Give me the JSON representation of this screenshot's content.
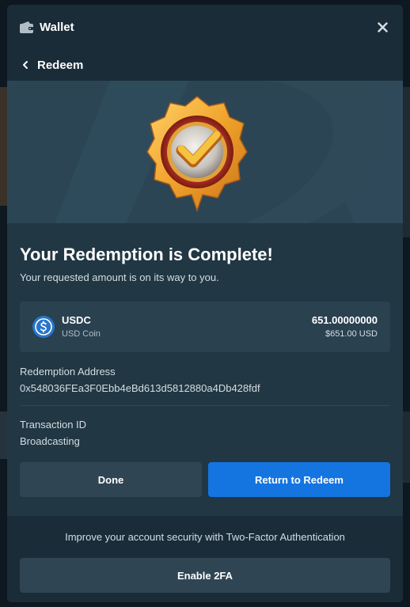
{
  "header": {
    "title": "Wallet",
    "icon": "wallet-icon",
    "close_icon": "close-icon"
  },
  "subheader": {
    "back_icon": "chevron-left-icon",
    "title": "Redeem"
  },
  "hero": {
    "badge_icon": "checkmark-badge-icon"
  },
  "main": {
    "title": "Your Redemption is Complete!",
    "subtitle": "Your requested amount is on its way to you."
  },
  "coin": {
    "icon": "usdc-icon",
    "symbol": "USDC",
    "name": "USD Coin",
    "amount": "651.00000000",
    "fiat": "$651.00 USD"
  },
  "redemption": {
    "label": "Redemption Address",
    "value": "0x548036FEa3F0Ebb4eBd613d5812880a4Db428fdf"
  },
  "transaction": {
    "label": "Transaction ID",
    "value": "Broadcasting"
  },
  "actions": {
    "done_label": "Done",
    "return_label": "Return to Redeem"
  },
  "footer": {
    "text": "Improve your account security with Two-Factor Authentication",
    "enable_label": "Enable 2FA"
  },
  "colors": {
    "modal_bg": "#213743",
    "header_bg": "#1a2c38",
    "primary_button": "#1475e1",
    "secondary_button": "#2f4553",
    "card_bg": "#2a4150"
  }
}
